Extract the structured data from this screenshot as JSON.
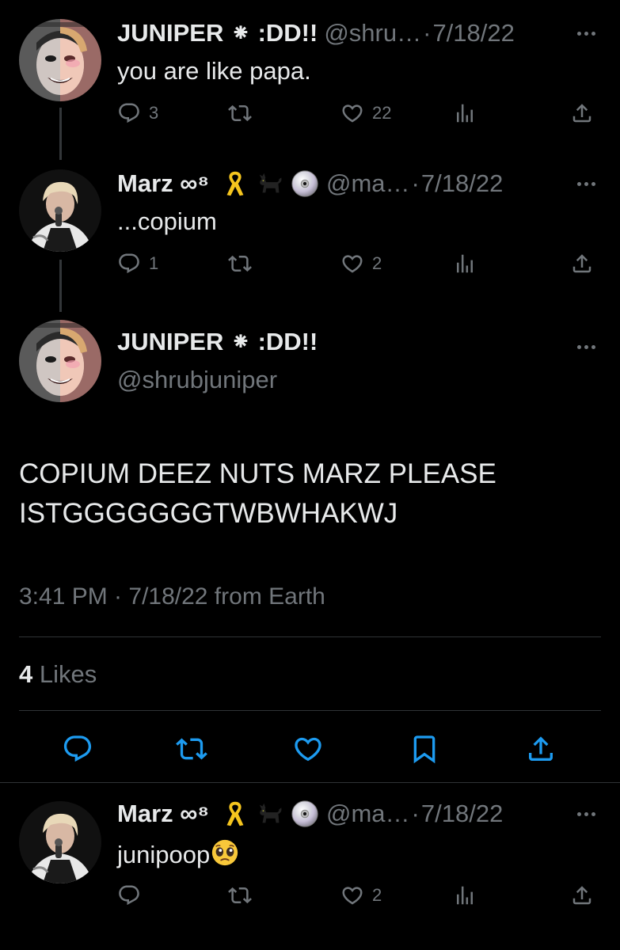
{
  "tweets": [
    {
      "name": "JUNIPER ⁕ :DD!!",
      "handle": "@shru…",
      "dot": "·",
      "date": "7/18/22",
      "text": "you are like papa.",
      "replies": "3",
      "likes": "22"
    },
    {
      "name": "Marz ∞⁸",
      "handle": "@ma…",
      "dot": "·",
      "date": "7/18/22",
      "text": "...copium",
      "replies": "1",
      "likes": "2",
      "badges": [
        "yellow-ribbon-emoji",
        "black-cat-emoji",
        "dvd-emoji"
      ]
    }
  ],
  "main_tweet": {
    "name": "JUNIPER ⁕ :DD!!",
    "handle": "@shrubjuniper",
    "text_line1": "COPIUM DEEZ NUTS MARZ PLEASE",
    "text_line2": "ISTGGGGGGGTWBWHAKWJ",
    "time": "3:41 PM · 7/18/22 from Earth",
    "likes_count": "4",
    "likes_label": "Likes"
  },
  "reply": {
    "name": "Marz ∞⁸",
    "handle": "@ma…",
    "dot": "·",
    "date": "7/18/22",
    "text": "junipoop",
    "likes": "2",
    "badges": [
      "yellow-ribbon-emoji",
      "black-cat-emoji",
      "dvd-emoji"
    ],
    "text_emoji": "pleading-face-emoji"
  },
  "colors": {
    "background": "#000000",
    "text": "#e7e9ea",
    "muted": "#71767b",
    "divider": "#2f3336"
  }
}
